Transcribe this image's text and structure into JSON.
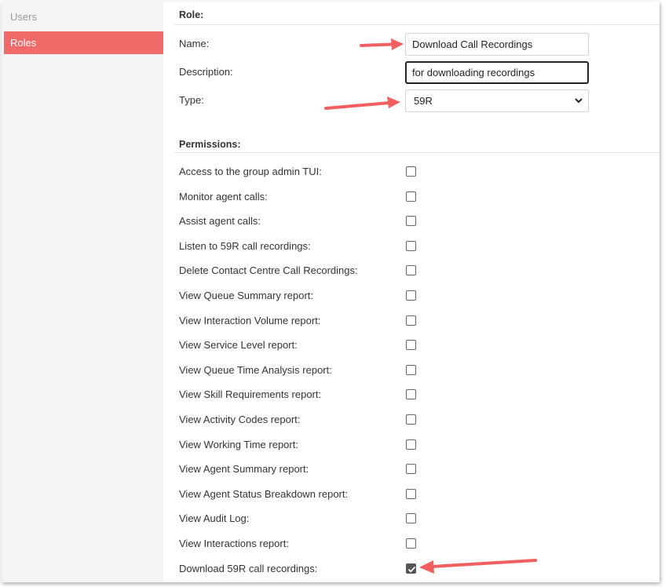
{
  "sidebar": {
    "items": [
      {
        "label": "Users",
        "active": false
      },
      {
        "label": "Roles",
        "active": true
      }
    ]
  },
  "role": {
    "section_title": "Role:",
    "name_label": "Name:",
    "name_value": "Download Call Recordings",
    "description_label": "Description:",
    "description_value": "for downloading recordings",
    "type_label": "Type:",
    "type_value": "59R"
  },
  "permissions": {
    "section_title": "Permissions:",
    "items": [
      {
        "label": "Access to the group admin TUI:",
        "checked": false
      },
      {
        "label": "Monitor agent calls:",
        "checked": false
      },
      {
        "label": "Assist agent calls:",
        "checked": false
      },
      {
        "label": "Listen to 59R call recordings:",
        "checked": false
      },
      {
        "label": "Delete Contact Centre Call Recordings:",
        "checked": false
      },
      {
        "label": "View Queue Summary report:",
        "checked": false
      },
      {
        "label": "View Interaction Volume report:",
        "checked": false
      },
      {
        "label": "View Service Level report:",
        "checked": false
      },
      {
        "label": "View Queue Time Analysis report:",
        "checked": false
      },
      {
        "label": "View Skill Requirements report:",
        "checked": false
      },
      {
        "label": "View Activity Codes report:",
        "checked": false
      },
      {
        "label": "View Working Time report:",
        "checked": false
      },
      {
        "label": "View Agent Summary report:",
        "checked": false
      },
      {
        "label": "View Agent Status Breakdown report:",
        "checked": false
      },
      {
        "label": "View Audit Log:",
        "checked": false
      },
      {
        "label": "View Interactions report:",
        "checked": false
      },
      {
        "label": "Download 59R call recordings:",
        "checked": true
      }
    ]
  },
  "colors": {
    "accent": "#f16a6a",
    "annotation_arrow": "#f06060"
  },
  "icons": {
    "select_arrow": "chevron-down-icon",
    "checkbox_mark": "check-icon",
    "annotation": "arrow-annotation-icon"
  }
}
